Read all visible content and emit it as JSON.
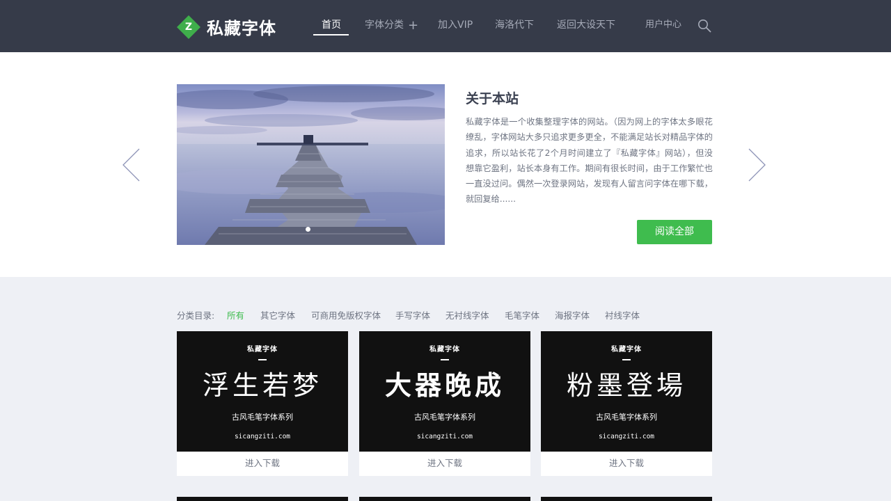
{
  "header": {
    "logo_letter": "Z",
    "logo_text": "私藏字体",
    "nav": [
      {
        "label": "首页"
      },
      {
        "label": "字体分类"
      },
      {
        "label": "加入VIP"
      },
      {
        "label": "海洛代下"
      },
      {
        "label": "返回大设天下"
      },
      {
        "label": "用户中心"
      }
    ],
    "nav_plus": "+"
  },
  "hero": {
    "title": "关于本站",
    "text": "私藏字体是一个收集整理字体的网站。（因为网上的字体太多眼花缭乱，字体网站大多只追求更多更全，不能满足站长对精品字体的追求，所以站长花了2个月时间建立了『私藏字体』网站），但没想靠它盈利，站长本身有工作。期间有很长时间，由于工作繁忙也一直没过问。偶然一次登录网站，发现有人留言问字体在哪下载，就回复给......",
    "button": "阅读全部"
  },
  "categories": {
    "label": "分类目录:",
    "items": [
      "所有",
      "其它字体",
      "可商用免版权字体",
      "手写字体",
      "无衬线字体",
      "毛笔字体",
      "海报字体",
      "衬线字体"
    ]
  },
  "cards": [
    {
      "brand": "私藏字体",
      "title": "浮生若梦",
      "subtitle": "古风毛笔字体系列",
      "site": "sicangziti.com",
      "action": "进入下载"
    },
    {
      "brand": "私藏字体",
      "title": "大器晚成",
      "subtitle": "古风毛笔字体系列",
      "site": "sicangziti.com",
      "action": "进入下载"
    },
    {
      "brand": "私藏字体",
      "title": "粉墨登場",
      "subtitle": "古风毛笔字体系列",
      "site": "sicangziti.com",
      "action": "进入下载"
    }
  ],
  "colors": {
    "header_bg": "#363b49",
    "accent_green": "#3fbc4e",
    "page_bg": "#eef0f5"
  }
}
